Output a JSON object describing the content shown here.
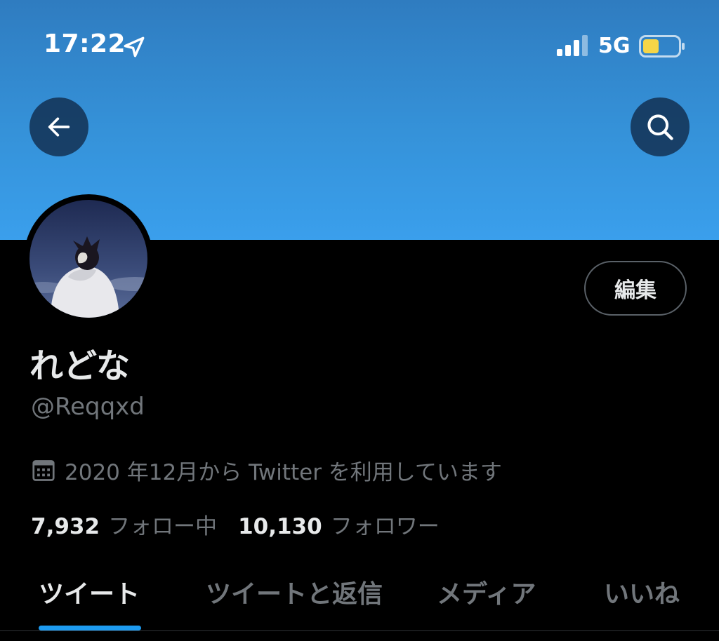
{
  "status_bar": {
    "time": "17:22",
    "network": "5G",
    "battery_color": "#f5d547"
  },
  "header": {
    "banner_color": "#3592d9",
    "back_icon": "arrow-left-icon",
    "search_icon": "search-icon"
  },
  "profile": {
    "edit_label": "編集",
    "display_name": "れどな",
    "handle": "@Reqqxd",
    "joined_text": "2020 年12月から Twitter を利用しています",
    "following_count": "7,932",
    "following_label": "フォロー中",
    "followers_count": "10,130",
    "followers_label": "フォロワー"
  },
  "tabs": [
    {
      "label": "ツイート",
      "active": true
    },
    {
      "label": "ツイートと返信",
      "active": false
    },
    {
      "label": "メディア",
      "active": false
    },
    {
      "label": "いいね",
      "active": false
    }
  ],
  "accent_color": "#1d9bf0"
}
